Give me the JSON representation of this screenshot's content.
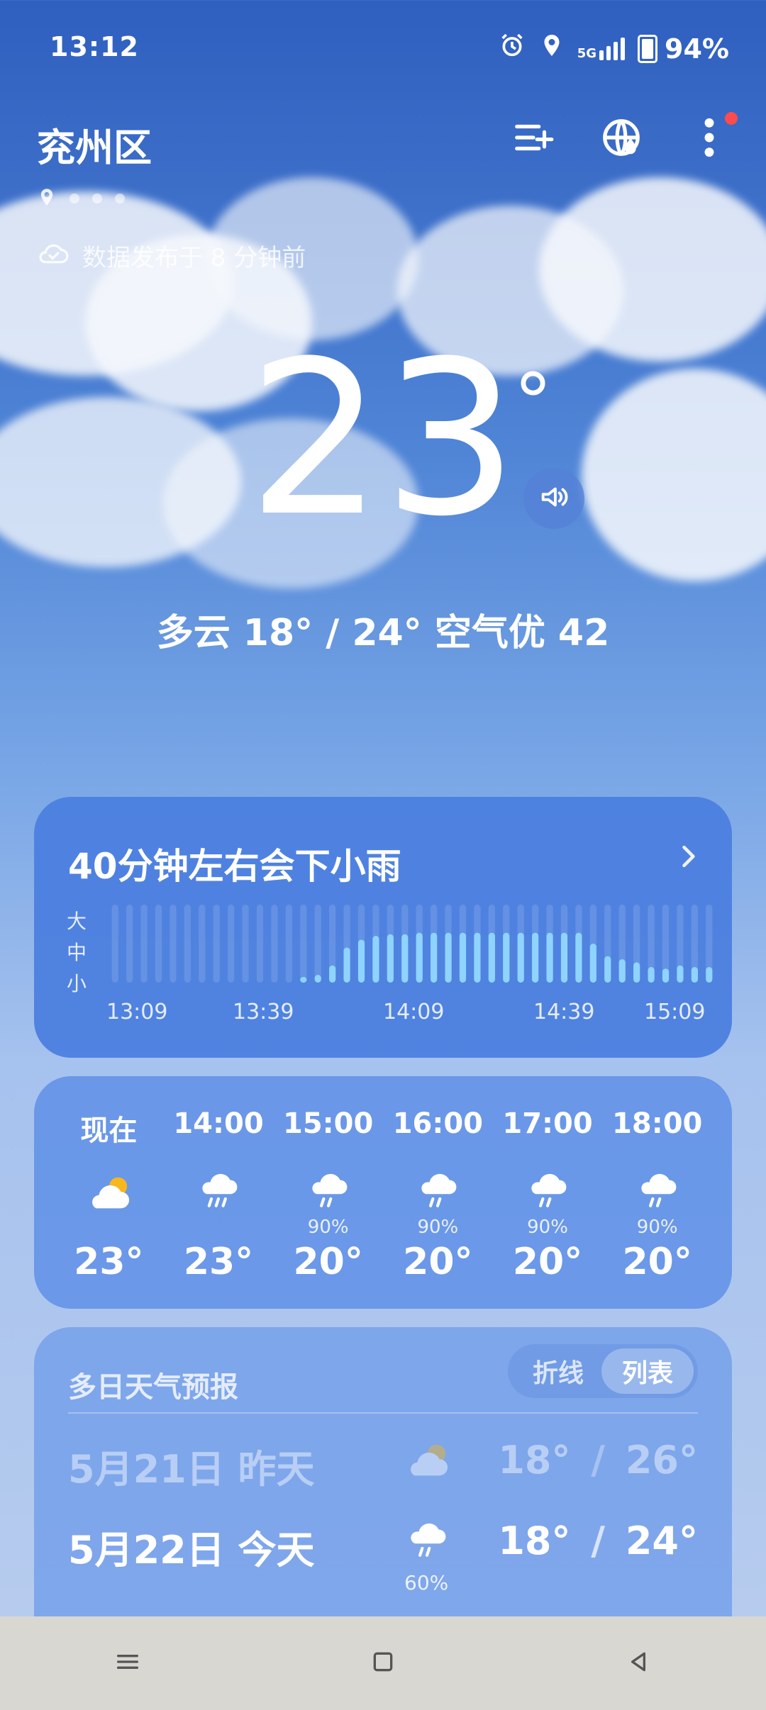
{
  "status_bar": {
    "time": "13:12",
    "network": "5G",
    "battery": "94%"
  },
  "header": {
    "city": "兖州区",
    "published": "数据发布于 8 分钟前"
  },
  "current": {
    "temperature": "23",
    "degree": "°",
    "summary": "多云  18° / 24°  空气优 42"
  },
  "precip": {
    "title": "40分钟左右会下小雨",
    "levels": [
      "大",
      "中",
      "小"
    ],
    "times": [
      "13:09",
      "13:39",
      "14:09",
      "14:39",
      "15:09"
    ],
    "intensity": [
      0,
      0,
      0,
      0,
      0,
      0,
      0,
      0,
      0,
      0,
      0,
      0,
      0,
      0.05,
      0.1,
      0.22,
      0.45,
      0.55,
      0.6,
      0.62,
      0.62,
      0.64,
      0.64,
      0.64,
      0.64,
      0.64,
      0.64,
      0.64,
      0.64,
      0.64,
      0.64,
      0.64,
      0.64,
      0.5,
      0.34,
      0.3,
      0.26,
      0.2,
      0.18,
      0.22,
      0.2,
      0.2
    ]
  },
  "hourly": [
    {
      "time": "现在",
      "icon": "partly-cloudy-sun-icon",
      "prob": "",
      "temp": "23°"
    },
    {
      "time": "14:00",
      "icon": "rain-cloud-icon",
      "prob": "",
      "temp": "23°"
    },
    {
      "time": "15:00",
      "icon": "rain-cloud-icon",
      "prob": "90%",
      "temp": "20°"
    },
    {
      "time": "16:00",
      "icon": "rain-cloud-icon",
      "prob": "90%",
      "temp": "20°"
    },
    {
      "time": "17:00",
      "icon": "rain-cloud-icon",
      "prob": "90%",
      "temp": "20°"
    },
    {
      "time": "18:00",
      "icon": "rain-cloud-icon",
      "prob": "90%",
      "temp": "20°"
    }
  ],
  "forecast": {
    "title": "多日天气预报",
    "toggle_line": "折线",
    "toggle_list": "列表",
    "days": [
      {
        "date": "5月21日  昨天",
        "icon": "partly-cloudy-sun-icon",
        "prob": "",
        "low": "18°",
        "high": "26°",
        "sep": "/"
      },
      {
        "date": "5月22日  今天",
        "icon": "rain-cloud-icon",
        "prob": "60%",
        "low": "18°",
        "high": "24°",
        "sep": "/"
      }
    ]
  },
  "colors": {
    "accent": "#4C7FDF",
    "rain_bar": "#8fd3ff"
  }
}
